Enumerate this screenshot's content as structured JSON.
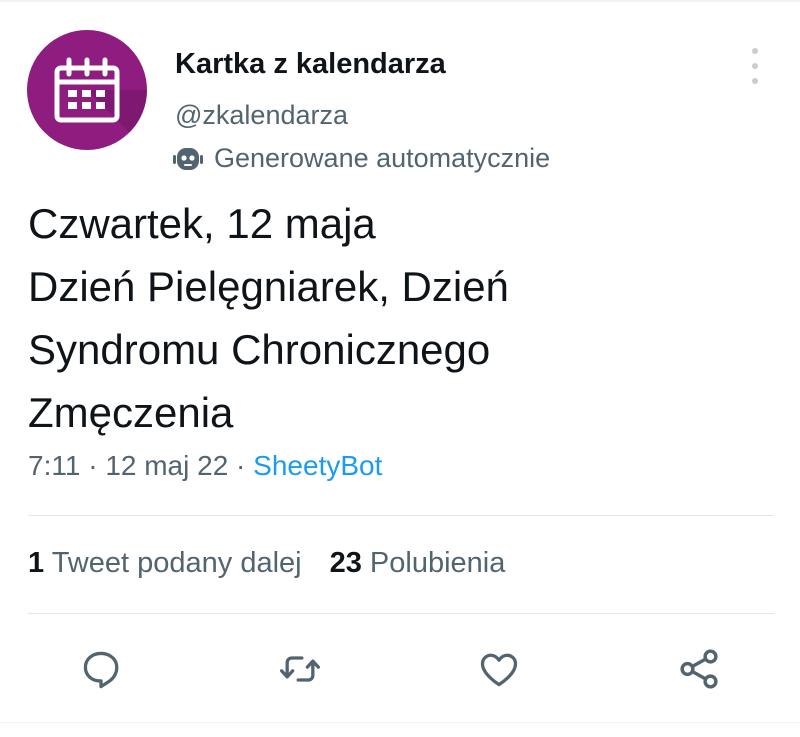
{
  "author": {
    "name": "Kartka z kalendarza",
    "handle": "@zkalendarza",
    "automated_label": "Generowane automatycznie",
    "avatar_color": "#8e1d7f",
    "avatar_icon": "calendar-icon"
  },
  "tweet": {
    "lines": [
      "Czwartek, 12 maja",
      "Dzień Pielęgniarek, Dzień",
      "Syndromu Chronicznego",
      "Zmęczenia"
    ]
  },
  "meta": {
    "time": "7:11",
    "separator": " · ",
    "date": "12 maj 22",
    "source": "SheetyBot"
  },
  "stats": {
    "retweets_count": "1",
    "retweets_label": "Tweet podany dalej",
    "likes_count": "23",
    "likes_label": "Polubienia"
  },
  "actions": [
    "reply-icon",
    "retweet-icon",
    "like-icon",
    "share-icon"
  ],
  "colors": {
    "link": "#1d9bf0",
    "secondary_text": "#536471",
    "icon": "#536471"
  }
}
